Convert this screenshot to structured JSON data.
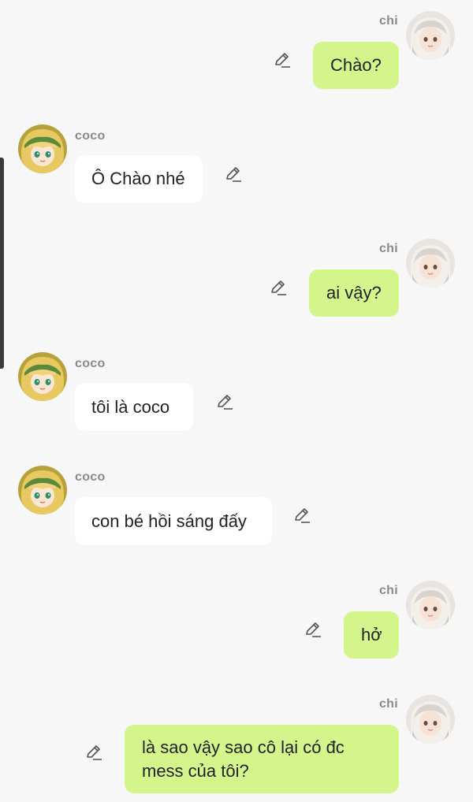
{
  "users": {
    "me": {
      "name": "chi"
    },
    "other": {
      "name": "coco"
    }
  },
  "colors": {
    "background": "#f7f7f7",
    "my_bubble": "#d4f58c",
    "other_bubble": "#ffffff",
    "name_text": "#8a8a8a"
  },
  "icons": {
    "edit": "pencil-edit-icon"
  },
  "messages": [
    {
      "sender": "chi",
      "text": "Chào?"
    },
    {
      "sender": "coco",
      "text": "Ô Chào nhé"
    },
    {
      "sender": "chi",
      "text": "ai vậy?"
    },
    {
      "sender": "coco",
      "text": "tôi là coco"
    },
    {
      "sender": "coco",
      "text": "con bé hồi sáng đấy"
    },
    {
      "sender": "chi",
      "text": "hở"
    },
    {
      "sender": "chi",
      "text": "là sao vậy sao cô lại có đc mess của tôi?"
    }
  ]
}
